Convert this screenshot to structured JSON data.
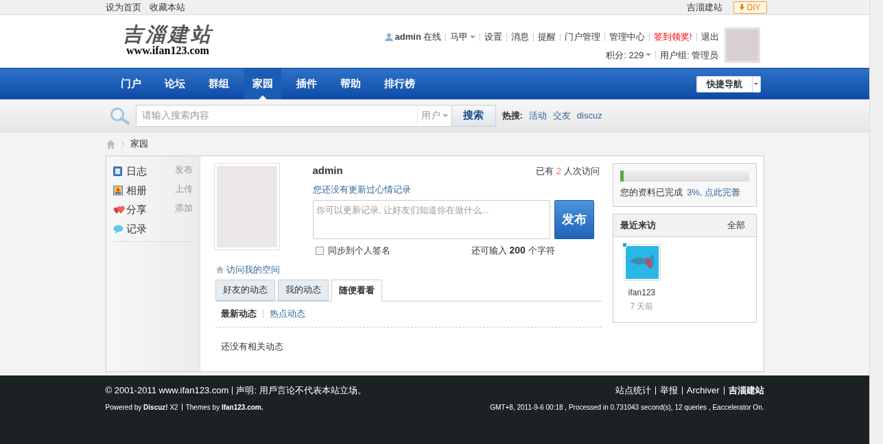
{
  "top_bar": {
    "links": [
      "设为首页",
      "收藏本站"
    ],
    "site_link": "吉淄建站",
    "diy_button": "DIY"
  },
  "header": {
    "logo": {
      "title": "吉淄建站",
      "url": "www.ifan123.com"
    },
    "user": {
      "name": "admin",
      "status": "在线",
      "menu": "马甲"
    },
    "links": [
      {
        "label": "设置",
        "highlight": false
      },
      {
        "label": "消息",
        "highlight": false
      },
      {
        "label": "提醒",
        "highlight": false
      },
      {
        "label": "门户管理",
        "highlight": false
      },
      {
        "label": "管理中心",
        "highlight": false
      },
      {
        "label": "签到领奖!",
        "highlight": true
      },
      {
        "label": "退出",
        "highlight": false
      }
    ],
    "points": "积分: 229",
    "group": "用户组: 管理员"
  },
  "nav": {
    "items": [
      {
        "label": "门户",
        "selected": false
      },
      {
        "label": "论坛",
        "selected": false
      },
      {
        "label": "群组",
        "selected": false
      },
      {
        "label": "家园",
        "selected": true
      },
      {
        "label": "插件",
        "selected": false
      },
      {
        "label": "帮助",
        "selected": false
      },
      {
        "label": "排行榜",
        "selected": false
      }
    ],
    "quick_nav": "快捷导航"
  },
  "search": {
    "placeholder": "请输入搜索内容",
    "scope": "用户",
    "button": "搜索",
    "hot_label": "热搜:",
    "hot": [
      "活动",
      "交友",
      "discuz"
    ]
  },
  "breadcrumb": [
    "家园"
  ],
  "sidebar": {
    "items": [
      {
        "kind": "blog",
        "label": "日志",
        "action": "发布"
      },
      {
        "kind": "album",
        "label": "相册",
        "action": "上传"
      },
      {
        "kind": "share",
        "label": "分享",
        "action": "添加"
      },
      {
        "kind": "record",
        "label": "记录"
      }
    ]
  },
  "profile": {
    "name": "admin",
    "visits_prefix": "已有",
    "visits": "2",
    "visits_suffix": "人次访问",
    "mood": "您还没有更新过心情记录",
    "record_placeholder": "你可以更新记录, 让好友们知道你在做什么...",
    "publish": "发布",
    "sync": {
      "label": "同步到个人签名",
      "checked": false
    },
    "remain_prefix": "还可输入",
    "remain": "200",
    "remain_suffix": "个字符",
    "visit_space": "访问我的空间"
  },
  "feed": {
    "tabs": [
      {
        "label": "好友的动态",
        "selected": false
      },
      {
        "label": "我的动态",
        "selected": false
      },
      {
        "label": "随便看看",
        "selected": true
      }
    ],
    "subtabs": [
      {
        "label": "最新动态",
        "selected": true
      },
      {
        "label": "热点动态",
        "selected": false
      }
    ],
    "empty": "还没有相关动态"
  },
  "completion": {
    "level": 0.03,
    "text": "您的资料已完成",
    "percent": "3%,",
    "link": "点此完善"
  },
  "visitors": {
    "title": "最近来访",
    "all": "全部",
    "items": [
      {
        "name": "ifan123",
        "time": "7 天前"
      }
    ]
  },
  "footer": {
    "copyright": "© 2001-2011 www.ifan123.com",
    "statement": "声明: 用戶言论不代表本站立场。",
    "links": [
      "站点统计",
      "举报",
      "Archiver"
    ],
    "site": "吉淄建站",
    "powered_prefix": "Powered by",
    "powered": "Discuz!",
    "version": "X2",
    "themes_prefix": "Themes by",
    "themes": "Ifan123.com.",
    "info": "GMT+8, 2011-9-6 00:18 , Processed in 0.731043 second(s), 12 queries , Eaccelerator On."
  }
}
